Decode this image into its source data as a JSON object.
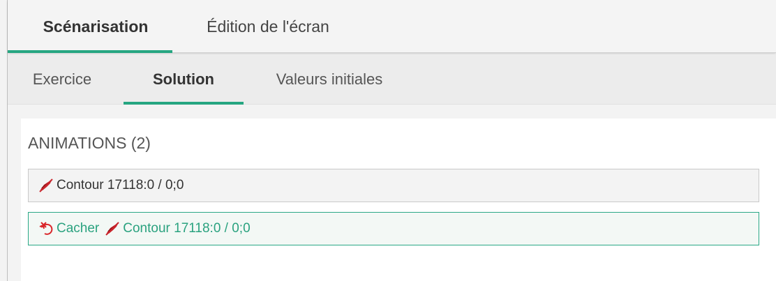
{
  "top_tabs": [
    {
      "label": "Scénarisation",
      "active": true
    },
    {
      "label": "Édition de l'écran",
      "active": false
    }
  ],
  "sub_tabs": [
    {
      "label": "Exercice",
      "active": false
    },
    {
      "label": "Solution",
      "active": true
    },
    {
      "label": "Valeurs initiales",
      "active": false
    }
  ],
  "animations": {
    "title": "ANIMATIONS (2)",
    "items": [
      {
        "icon": "contour-brush-icon",
        "text": "Contour 17118:0 / 0;0"
      },
      {
        "action_icon": "hide-undo-icon",
        "action_label": "Cacher",
        "icon": "contour-brush-icon",
        "text": "Contour 17118:0 / 0;0",
        "selected": true
      }
    ]
  },
  "colors": {
    "accent": "#26a681",
    "icon_red": "#d9262a"
  }
}
